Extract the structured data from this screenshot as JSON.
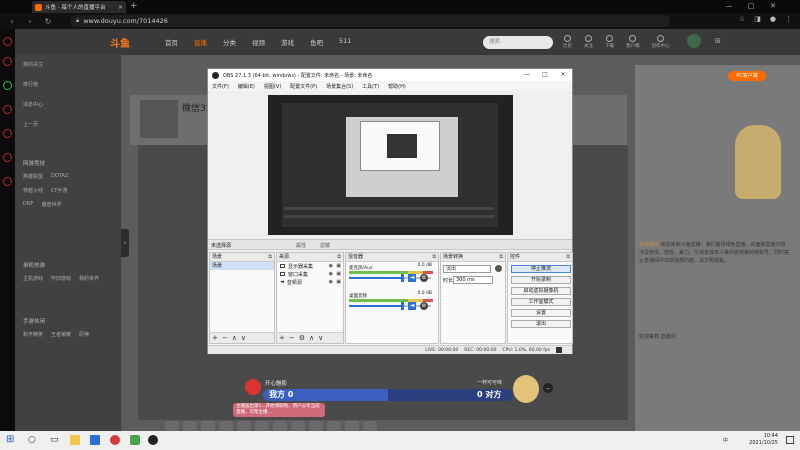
{
  "browser": {
    "tab_title": "斗鱼 - 每个人的直播平台",
    "url": "www.douyu.com/7014426"
  },
  "site": {
    "logo": "斗鱼",
    "nav": [
      "首页",
      "直播",
      "分类",
      "视频",
      "游戏",
      "鱼吧",
      "511"
    ],
    "search_placeholder": "搜索",
    "tools": [
      "历史",
      "关注",
      "下载",
      "客户端",
      "创作中心"
    ],
    "streamer_name": "微信35",
    "level_badge": "PC客户端"
  },
  "sidebar": {
    "top_items": [
      "我的关注",
      "排行榜",
      "消息中心",
      "上一页"
    ],
    "sections": [
      {
        "title": "网游竞技",
        "items": [
          "英雄联盟",
          "DOTA2",
          "穿越火线",
          "CF手游",
          "DNF",
          "魔兽世界"
        ]
      },
      {
        "title": "单机热游",
        "items": [
          "主机游戏",
          "怀旧游戏",
          "我的世界"
        ]
      },
      {
        "title": "手游休闲",
        "items": [
          "和平精英",
          "王者荣耀",
          "原神"
        ]
      }
    ]
  },
  "obs": {
    "title": "OBS 27.1.3 (64-bit, windows) - 配置文件: 未命名 - 场景: 未命名",
    "menu": [
      "文件(F)",
      "编辑(E)",
      "视图(V)",
      "配置文件(P)",
      "场景集合(S)",
      "工具(T)",
      "帮助(H)"
    ],
    "scene_header": "未选择源",
    "props_label": "属性",
    "filters_label": "滤镜",
    "docks": {
      "scenes": {
        "title": "场景",
        "items": [
          "场景"
        ]
      },
      "sources": {
        "title": "来源",
        "items": [
          "显示器采集",
          "窗口采集",
          "音频源"
        ]
      },
      "mixer": {
        "title": "混音器",
        "tracks": [
          {
            "name": "桌面音频",
            "db": "0.0 dB"
          },
          {
            "name": "麦克风/Aux",
            "db": "0.0 dB"
          }
        ]
      },
      "transitions": {
        "title": "场景转换",
        "type": "淡出",
        "duration_label": "时长",
        "duration": "300 ms"
      },
      "controls": {
        "title": "控件",
        "buttons": [
          "停止推流",
          "开始录制",
          "启动虚拟摄像机",
          "工作室模式",
          "设置",
          "退出"
        ]
      }
    },
    "status": {
      "live": "LIVE: 00:00:00",
      "rec": "REC: 00:00:00",
      "cpu": "CPU: 1.0%, 60.00 fps"
    }
  },
  "player": {
    "left_name": "开心魅影",
    "left_score": "我方 0",
    "right_name": "一杯可可味",
    "right_score": "0 对方",
    "gift_notice": "主播送出第1...开始领取啦，用户分享当前直播，可帮主播..."
  },
  "right_panel": {
    "tag": "PC客户端",
    "notice_title": "系统提示",
    "notice_text": "欢迎来到斗鱼直播！我们倡导绿色直播，封面和直播内容涉及色情、低俗、暴力、引诱未成年人等内容将被封停账号，同时禁止直播间中出现违规内容。请文明观看。",
    "footer": "欢迎来到 直播间"
  },
  "taskbar": {
    "time": "10:44",
    "date": "2021/10/25",
    "tray": "中"
  },
  "colors": {
    "accent": "#ff6a00",
    "obs_active": "#4a86d9",
    "rail": "#c0212b"
  }
}
